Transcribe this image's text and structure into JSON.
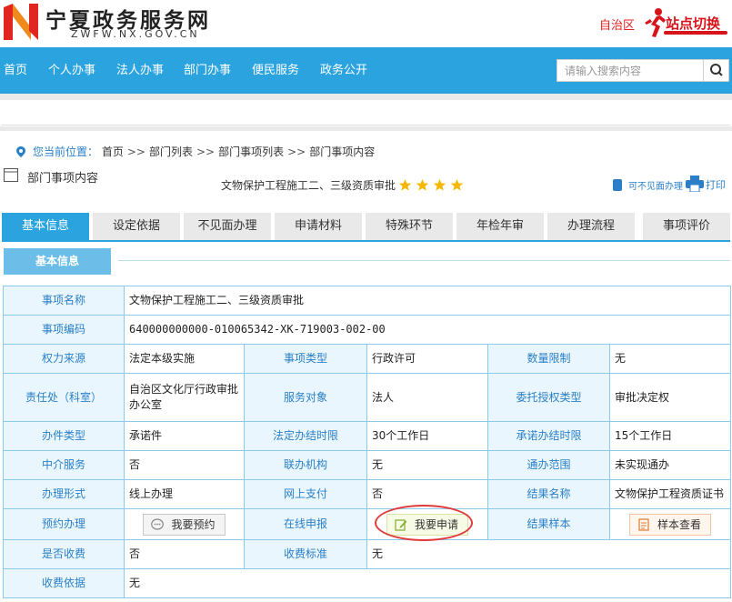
{
  "site": {
    "title": "宁夏政务服务网",
    "domain": "ZWFW.NX.GOV.CN",
    "region": "自治区",
    "switch_label": "站点切换"
  },
  "nav": {
    "items": [
      "首页",
      "个人办事",
      "法人办事",
      "部门办事",
      "便民服务",
      "政务公开"
    ],
    "search_placeholder": "请输入搜索内容"
  },
  "breadcrumb": {
    "label": "您当前位置：",
    "items": [
      "首页",
      "部门列表",
      "部门事项列表",
      "部门事项内容"
    ],
    "separator": ">>"
  },
  "page": {
    "title": "部门事项内容",
    "item_title": "文物保护工程施工二、三级资质审批",
    "rating_stars": 4,
    "remote_label": "可不见面办理",
    "print_label": "打印"
  },
  "tabs": [
    "基本信息",
    "设定依据",
    "不见面办理",
    "申请材料",
    "特殊环节",
    "年检年审",
    "办理流程",
    "事项评价"
  ],
  "active_tab": 0,
  "section_title": "基本信息",
  "info": {
    "item_name_k": "事项名称",
    "item_name_v": "文物保护工程施工二、三级资质审批",
    "item_code_k": "事项编码",
    "item_code_v": "640000000000-010065342-XK-719003-002-00",
    "power_src_k": "权力来源",
    "power_src_v": "法定本级实施",
    "item_type_k": "事项类型",
    "item_type_v": "行政许可",
    "qty_limit_k": "数量限制",
    "qty_limit_v": "无",
    "dept_k": "责任处（科室）",
    "dept_v": "自治区文化厅行政审批办公室",
    "target_k": "服务对象",
    "target_v": "法人",
    "entrust_k": "委托授权类型",
    "entrust_v": "审批决定权",
    "handle_type_k": "办件类型",
    "handle_type_v": "承诺件",
    "legal_limit_k": "法定办结时限",
    "legal_limit_v": "30个工作日",
    "promise_limit_k": "承诺办结时限",
    "promise_limit_v": "15个工作日",
    "agency_k": "中介服务",
    "agency_v": "否",
    "joint_k": "联办机构",
    "joint_v": "无",
    "universal_k": "通办范围",
    "universal_v": "未实现通办",
    "form_k": "办理形式",
    "form_v": "线上办理",
    "pay_k": "网上支付",
    "pay_v": "否",
    "result_name_k": "结果名称",
    "result_name_v": "文物保护工程资质证书",
    "booking_k": "预约办理",
    "booking_btn": "我要预约",
    "online_k": "在线申报",
    "online_btn": "我要申请",
    "sample_k": "结果样本",
    "sample_btn": "样本查看",
    "fee_k": "是否收费",
    "fee_v": "否",
    "fee_std_k": "收费标准",
    "fee_std_v": "无",
    "fee_basis_k": "收费依据",
    "fee_basis_v": "无"
  },
  "colors": {
    "brand_blue": "#2aa3df",
    "label_blue": "#2a7fc7",
    "alert_red": "#d7141a",
    "star_gold": "#f5b800"
  }
}
